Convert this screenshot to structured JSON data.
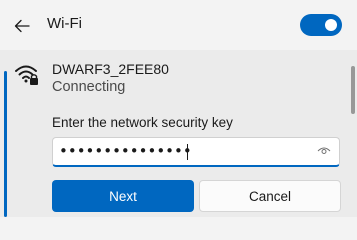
{
  "header": {
    "title": "Wi-Fi",
    "wifi_enabled": true,
    "back_icon": "back-arrow-icon"
  },
  "network": {
    "name": "DWARF3_2FEE80",
    "status": "Connecting",
    "icon": "wifi-secured-icon"
  },
  "security_prompt": {
    "label": "Enter the network security key",
    "masked_value": "•••••••••••••••",
    "reveal_icon": "eye-icon"
  },
  "buttons": {
    "next_label": "Next",
    "cancel_label": "Cancel"
  },
  "colors": {
    "accent": "#0067c0",
    "background": "#f3f3f3",
    "card_background": "#ebebeb"
  }
}
